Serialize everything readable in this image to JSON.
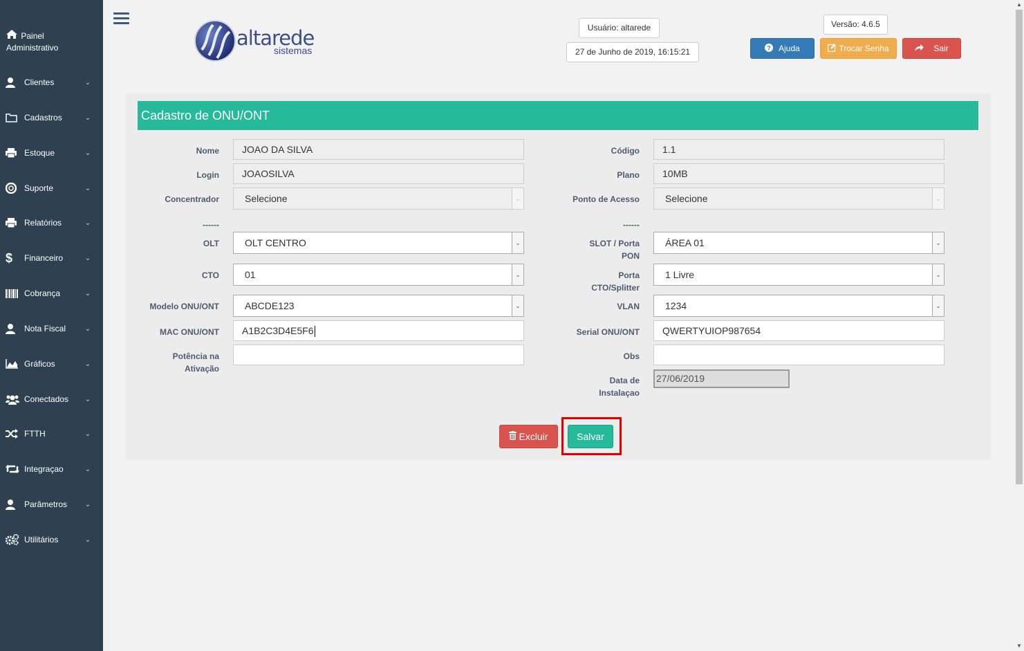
{
  "sidebar": {
    "brand_line1": "Painel",
    "brand_line2": "Administrativo",
    "items": [
      {
        "label": "Clientes",
        "icon": "user-icon"
      },
      {
        "label": "Cadastros",
        "icon": "folder-icon"
      },
      {
        "label": "Estoque",
        "icon": "printer-icon"
      },
      {
        "label": "Suporte",
        "icon": "lifebuoy-icon"
      },
      {
        "label": "Relatórios",
        "icon": "printer-icon"
      },
      {
        "label": "Financeiro",
        "icon": "dollar-icon"
      },
      {
        "label": "Cobrança",
        "icon": "barcode-icon"
      },
      {
        "label": "Nota Fiscal",
        "icon": "user-icon"
      },
      {
        "label": "Gráficos",
        "icon": "area-chart-icon"
      },
      {
        "label": "Conectados",
        "icon": "users-icon"
      },
      {
        "label": "FTTH",
        "icon": "random-icon"
      },
      {
        "label": "Integraçao",
        "icon": "retweet-icon"
      },
      {
        "label": "Parâmetros",
        "icon": "user-icon"
      },
      {
        "label": "Utilitários",
        "icon": "cogs-icon"
      }
    ]
  },
  "header": {
    "logo_word": "altarede",
    "logo_sub": "sistemas",
    "usuario": "Usuário: altarede",
    "datetime": "27 de Junho de 2019, 16:15:21",
    "versao": "Versão: 4.6.5",
    "btn_ajuda": "Ajuda",
    "btn_trocar": "Trocar Senha",
    "btn_sair": "Sair"
  },
  "form": {
    "title": "Cadastro de ONU/ONT",
    "nome_label": "Nome",
    "nome_value": "JOAO DA SILVA",
    "codigo_label": "Código",
    "codigo_value": "1.1",
    "login_label": "Login",
    "login_value": "JOAOSILVA",
    "plano_label": "Plano",
    "plano_value": "10MB",
    "concentrador_label": "Concentrador",
    "concentrador_value": "Selecione",
    "ponto_label": "Ponto de Acesso",
    "ponto_value": "Selecione",
    "sep_left": "------",
    "sep_right": "------",
    "olt_label": "OLT",
    "olt_value": "OLT CENTRO",
    "slot_label_1": "SLOT / Porta",
    "slot_label_2": "PON",
    "slot_value": "ÁREA 01",
    "cto_label": "CTO",
    "cto_value": "01",
    "porta_label_1": "Porta",
    "porta_label_2": "CTO/Splitter",
    "porta_value": "1 Livre",
    "modelo_label": "Modelo ONU/ONT",
    "modelo_value": "ABCDE123",
    "vlan_label": "VLAN",
    "vlan_value": "1234",
    "mac_label": "MAC ONU/ONT",
    "mac_value": "A1B2C3D4E5F6",
    "serial_label": "Serial ONU/ONT",
    "serial_value": "QWERTYUIOP987654",
    "potencia_label_1": "Potência na",
    "potencia_label_2": "Ativação",
    "potencia_value": "",
    "obs_label": "Obs",
    "obs_value": "",
    "data_label_1": "Data de",
    "data_label_2": "Instalaçao",
    "data_value": "27/06/2019",
    "btn_excluir": "Excluir",
    "btn_salvar": "Salvar"
  },
  "colors": {
    "sidebar_bg": "#2f4050",
    "accent_green": "#26b99a",
    "btn_blue": "#337ab7",
    "btn_orange": "#f0ad4e",
    "btn_red": "#d9534f",
    "highlight": "#e00000"
  }
}
